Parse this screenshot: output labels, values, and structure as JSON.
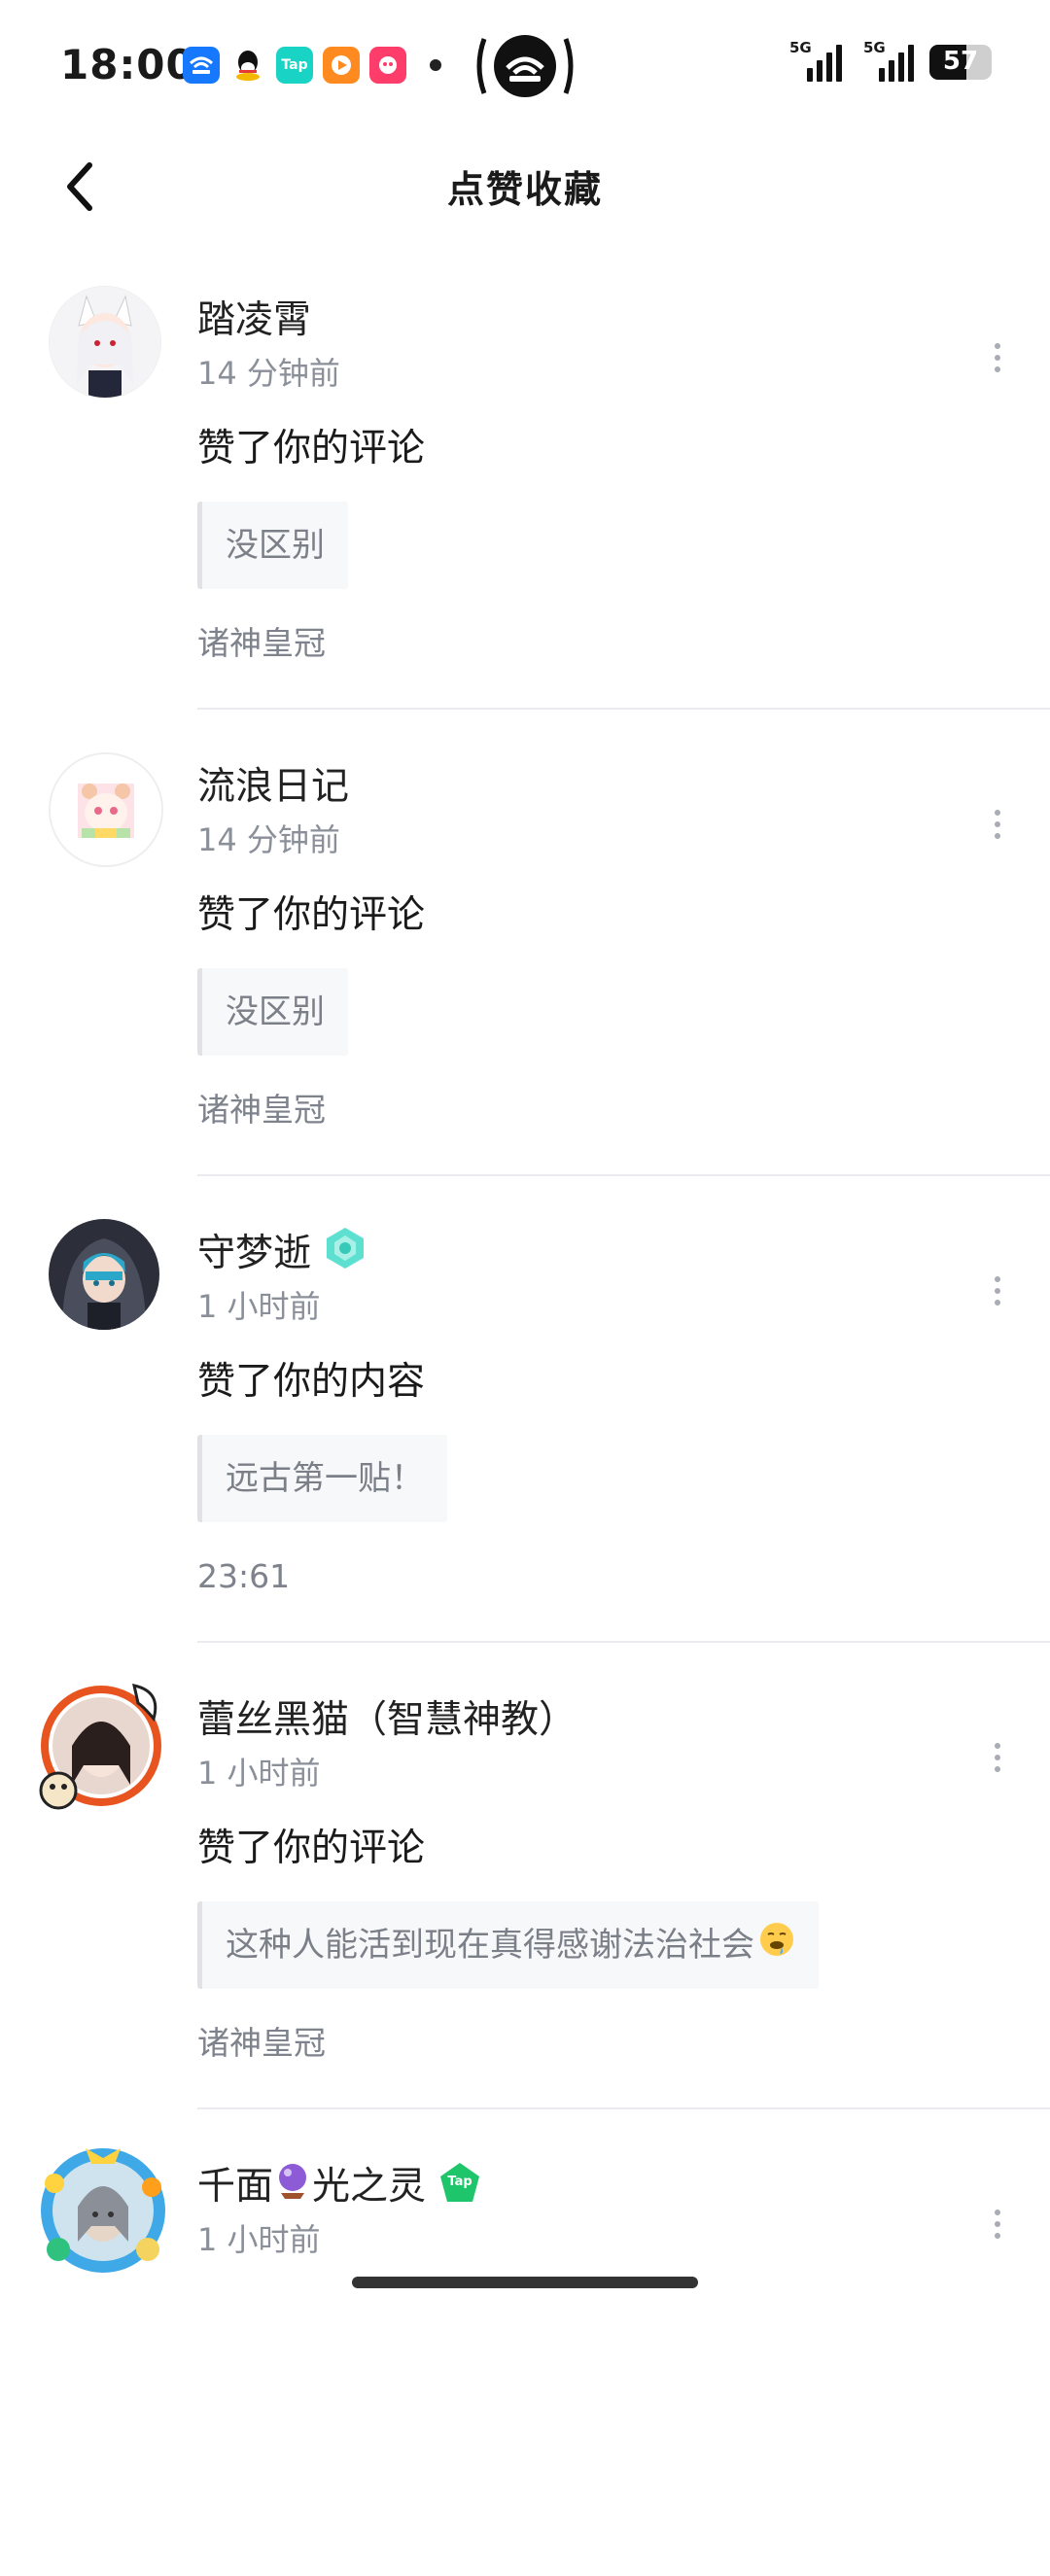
{
  "status_bar": {
    "time": "18:00",
    "app_icons": [
      "wifi-app-icon",
      "qq-icon",
      "taptap-icon",
      "video-app-icon",
      "shopping-app-icon"
    ],
    "tap_label": "Tap",
    "signal_labels": [
      "5G",
      "5G"
    ],
    "battery": "57"
  },
  "header": {
    "title": "点赞收藏"
  },
  "notifications": [
    {
      "name": "踏凌霄",
      "time": "14 分钟前",
      "action": "赞了你的评论",
      "quote": "没区别",
      "source": "诸神皇冠",
      "has_badge": false
    },
    {
      "name": "流浪日记",
      "time": "14 分钟前",
      "action": "赞了你的评论",
      "quote": "没区别",
      "source": "诸神皇冠",
      "has_badge": false
    },
    {
      "name": "守梦逝",
      "time": "1 小时前",
      "action": "赞了你的内容",
      "quote": "远古第一贴！",
      "source": "23:61",
      "has_badge": true,
      "badge_icon": "teal-level-badge-icon"
    },
    {
      "name": "蕾丝黑猫（智慧神教）",
      "time": "1 小时前",
      "action": "赞了你的评论",
      "quote": "这种人能活到现在真得感谢法治社会",
      "quote_emoji": "drooling-face-emoji",
      "source": "诸神皇冠",
      "has_badge": false
    },
    {
      "name_parts": [
        "千面",
        "光之灵"
      ],
      "name_emoji": "crystal-ball-emoji",
      "time": "1 小时前",
      "has_badge": true,
      "badge_icon": "taptap-verified-badge-icon",
      "badge_label": "Tap"
    }
  ],
  "colors": {
    "accent_teal": "#38d6c4",
    "tap_green": "#1fc56b",
    "meta_gray": "#8a8f99"
  }
}
